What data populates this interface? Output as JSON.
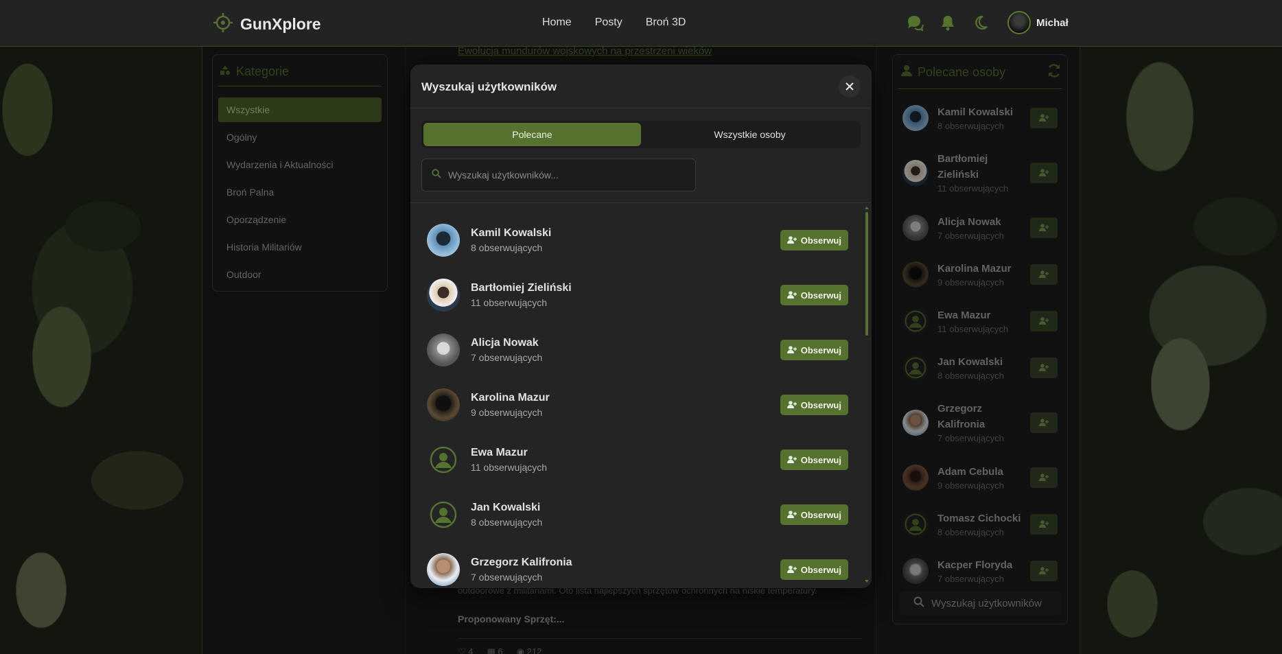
{
  "brand": {
    "title": "GunXplore",
    "accent": "#55722e"
  },
  "nav": {
    "items": [
      "Home",
      "Posty",
      "Broń 3D"
    ]
  },
  "user": {
    "name": "Michał"
  },
  "categories": {
    "title": "Kategorie",
    "items": [
      "Wszystkie",
      "Ogólny",
      "Wydarzenia i Aktualności",
      "Broń Palna",
      "Oporządzenie",
      "Historia Militariów",
      "Outdoor"
    ],
    "active_index": 0
  },
  "feed": {
    "post_title": "Ewolucja mundurów wojskowych na przestrzeni wieków",
    "post_excerpt": "outdoorowe z militariami. Oto lista najlepszych sprzętów ochronnych na niskie temperatury.",
    "section_label": "Proponowany Sprzęt:...",
    "stats": [
      "4",
      "6",
      "212"
    ]
  },
  "recommended": {
    "title": "Polecane osoby",
    "search_label": "Wyszukaj użytkowników",
    "people": [
      {
        "name": "Kamil Kowalski",
        "followers": "8 obserwujących",
        "avatar": "kamil"
      },
      {
        "name": "Bartłomiej Zieliński",
        "followers": "11 obserwujących",
        "avatar": "bartek"
      },
      {
        "name": "Alicja Nowak",
        "followers": "7 obserwujących",
        "avatar": "alicja"
      },
      {
        "name": "Karolina Mazur",
        "followers": "9 obserwujących",
        "avatar": "karolina"
      },
      {
        "name": "Ewa Mazur",
        "followers": "11 obserwujących",
        "avatar": "default"
      },
      {
        "name": "Jan Kowalski",
        "followers": "8 obserwujących",
        "avatar": "default"
      },
      {
        "name": "Grzegorz Kalifronia",
        "followers": "7 obserwujących",
        "avatar": "grzegorz"
      },
      {
        "name": "Adam Cebula",
        "followers": "9 obserwujących",
        "avatar": "adam"
      },
      {
        "name": "Tomasz Cichocki",
        "followers": "8 obserwujących",
        "avatar": "default"
      },
      {
        "name": "Kacper Floryda",
        "followers": "7 obserwujących",
        "avatar": "kacper"
      }
    ]
  },
  "modal": {
    "title": "Wyszukaj użytkowników",
    "tabs": [
      "Polecane",
      "Wszystkie osoby"
    ],
    "active_tab": 0,
    "search_placeholder": "Wyszukaj użytkowników...",
    "follow_label": "Obserwuj",
    "users": [
      {
        "name": "Kamil Kowalski",
        "followers": "8 obserwujących",
        "avatar": "kamil"
      },
      {
        "name": "Bartłomiej Zieliński",
        "followers": "11 obserwujących",
        "avatar": "bartek"
      },
      {
        "name": "Alicja Nowak",
        "followers": "7 obserwujących",
        "avatar": "alicja"
      },
      {
        "name": "Karolina Mazur",
        "followers": "9 obserwujących",
        "avatar": "karolina"
      },
      {
        "name": "Ewa Mazur",
        "followers": "11 obserwujących",
        "avatar": "default"
      },
      {
        "name": "Jan Kowalski",
        "followers": "8 obserwujących",
        "avatar": "default"
      },
      {
        "name": "Grzegorz Kalifronia",
        "followers": "7 obserwujących",
        "avatar": "grzegorz"
      }
    ]
  }
}
